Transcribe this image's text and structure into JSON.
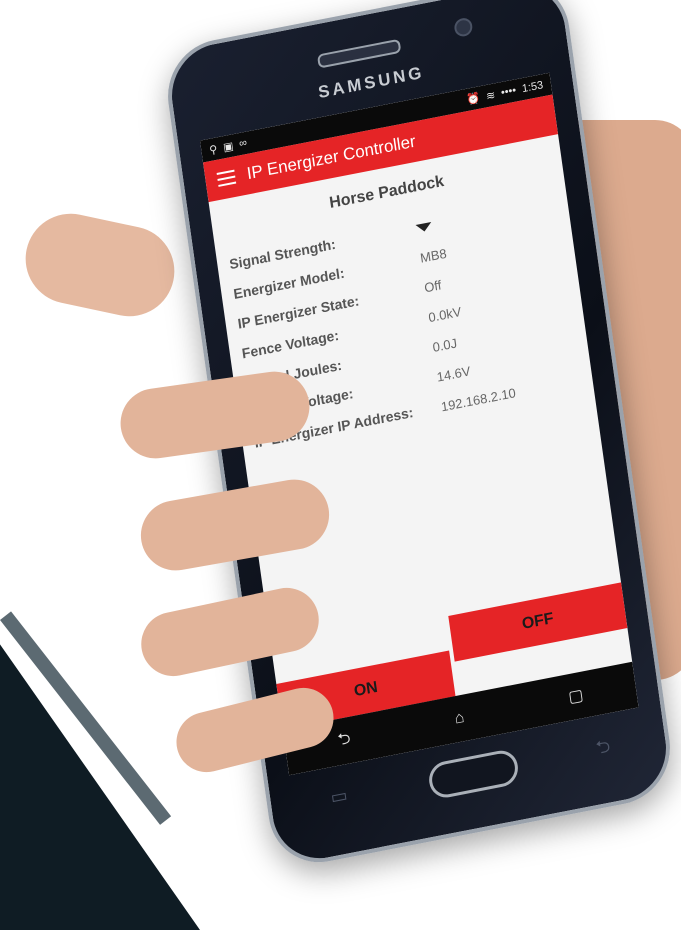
{
  "device": {
    "brand": "SAMSUNG"
  },
  "status_bar": {
    "time": "1:53",
    "signal_dots": "••••"
  },
  "app": {
    "title": "IP Energizer Controller"
  },
  "page": {
    "heading": "Horse Paddock"
  },
  "fields": [
    {
      "label": "Signal Strength:",
      "value": "",
      "icon": "signal-icon"
    },
    {
      "label": "Energizer Model:",
      "value": "MB8"
    },
    {
      "label": "IP Energizer State:",
      "value": "Off"
    },
    {
      "label": "Fence Voltage:",
      "value": "0.0kV"
    },
    {
      "label": "Stored Joules:",
      "value": "0.0J"
    },
    {
      "label": "Supply Voltage:",
      "value": "14.6V"
    },
    {
      "label": "IP Energizer IP Address:",
      "value": "192.168.2.10"
    }
  ],
  "buttons": {
    "on": "ON",
    "off": "OFF"
  },
  "nav": {
    "back": "⮌",
    "home": "⌂",
    "recents": "▢"
  },
  "colors": {
    "accent": "#e52426",
    "screen_bg": "#f4f4f4",
    "phone_body": "#0b0f18"
  }
}
